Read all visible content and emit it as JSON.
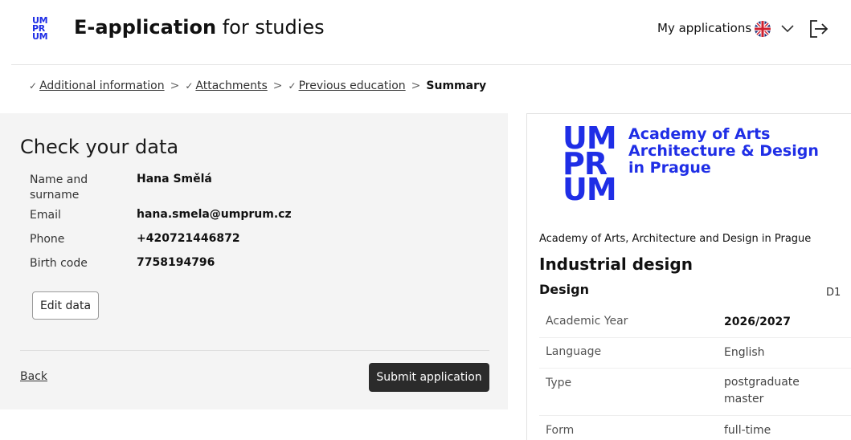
{
  "header": {
    "logo_lines": [
      "UM",
      "PR",
      "UM"
    ],
    "title_bold": "E-application",
    "title_rest": " for studies",
    "my_applications": "My applications",
    "language_icon": "uk-flag-icon",
    "dropdown_icon": "chevron-down-icon",
    "logout_icon": "logout-icon"
  },
  "breadcrumb": {
    "items": [
      {
        "label": "Additional information"
      },
      {
        "label": "Attachments"
      },
      {
        "label": "Previous education"
      }
    ],
    "separator": ">",
    "current": "Summary"
  },
  "check": {
    "title": "Check your data",
    "rows": [
      {
        "label": "Name and surname",
        "value": "Hana Smělá"
      },
      {
        "label": "Email",
        "value": "hana.smela@umprum.cz"
      },
      {
        "label": "Phone",
        "value": "+420721446872"
      },
      {
        "label": "Birth code",
        "value": "7758194796"
      }
    ],
    "edit_label": "Edit data",
    "back_label": "Back",
    "submit_label": "Submit application"
  },
  "programme": {
    "logo_lines": [
      "UM",
      "PR",
      "UM"
    ],
    "logo_text": [
      "Academy of Arts",
      "Architecture & Design",
      "in Prague"
    ],
    "institution": "Academy of Arts, Architecture and Design in Prague",
    "name": "Industrial design",
    "specialization": "Design",
    "code": "D1",
    "details": [
      {
        "label": "Academic Year",
        "value": "2026/2027"
      },
      {
        "label": "Language",
        "value": "English"
      },
      {
        "label": "Type",
        "value": "postgraduate master"
      },
      {
        "label": "Form",
        "value": "full-time"
      }
    ]
  },
  "colors": {
    "brand_blue": "#1f2ee6",
    "submit_bg": "#2b2b2b",
    "card_bg": "#f4f4f4"
  }
}
